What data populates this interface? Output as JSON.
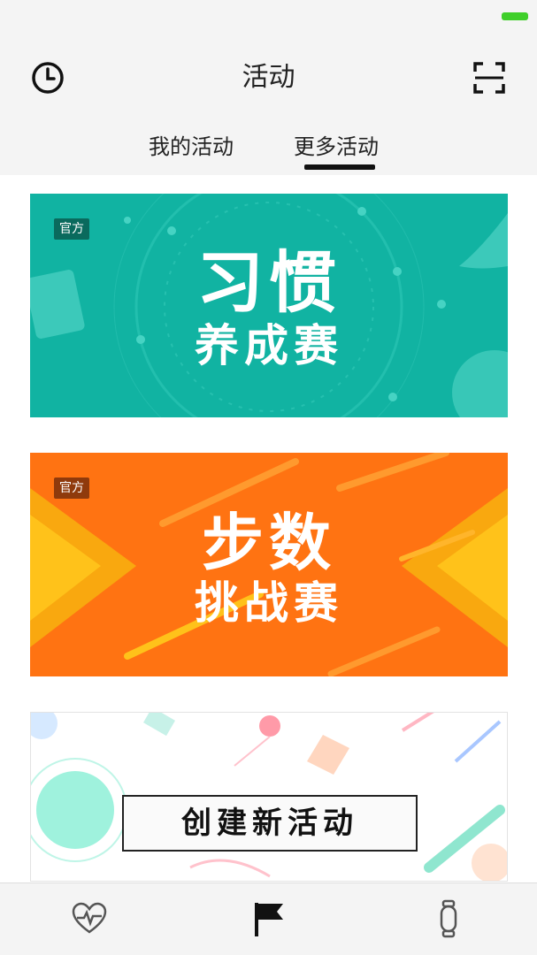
{
  "header": {
    "title": "活动",
    "left_icon": "history-clock-icon",
    "right_icon": "scan-icon"
  },
  "tabs": [
    {
      "label": "我的活动",
      "active": false
    },
    {
      "label": "更多活动",
      "active": true
    }
  ],
  "cards": [
    {
      "badge": "官方",
      "line1": "习惯",
      "line2": "养成赛",
      "color": "#11b3a2"
    },
    {
      "badge": "官方",
      "line1": "步数",
      "line2": "挑战赛",
      "color": "#ff7312"
    },
    {
      "button_label": "创建新活动"
    }
  ],
  "bottom_nav": {
    "items": [
      {
        "icon": "heart-pulse-icon"
      },
      {
        "icon": "flag-icon",
        "active": true
      },
      {
        "icon": "band-icon"
      }
    ]
  },
  "colors": {
    "accent_green": "#3fcf2a",
    "teal": "#11b3a2",
    "orange": "#ff7312"
  }
}
